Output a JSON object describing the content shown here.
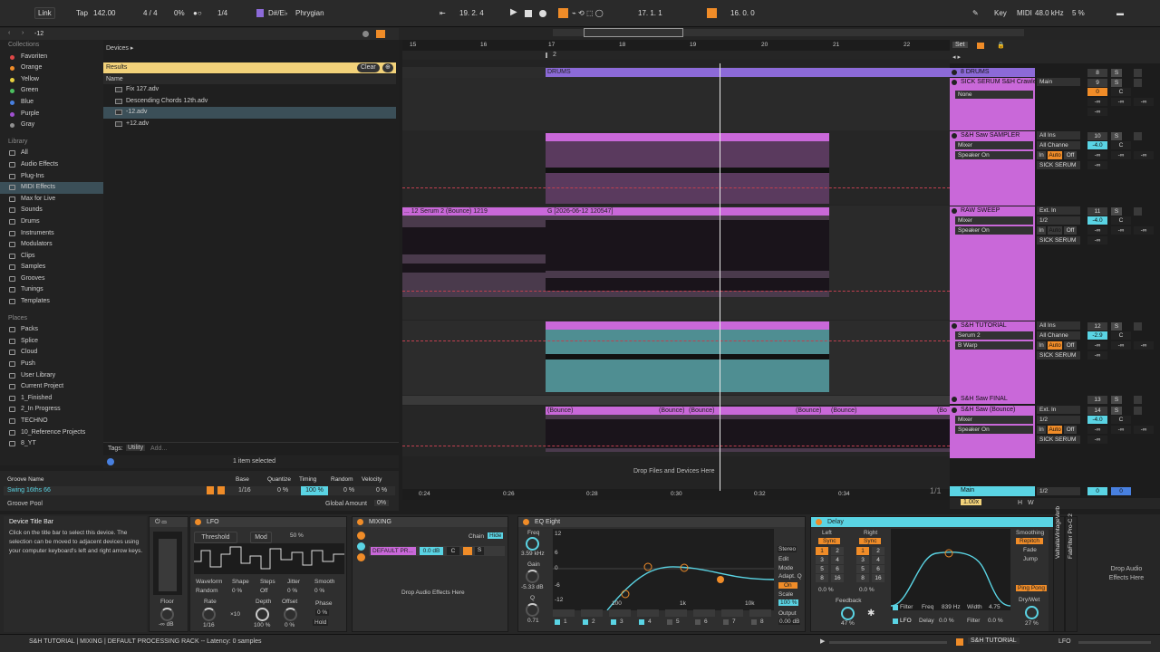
{
  "topbar": {
    "link": "Link",
    "tap": "Tap",
    "tempo": "142.00",
    "signature": "4 / 4",
    "cpu_pct": "0%",
    "quantize": "1/4",
    "key_root": "D#/E♭",
    "scale": "Phrygian",
    "arrangement_pos": "19.  2.  4",
    "loop_start": "17.  1.  1",
    "loop_len": "16.  0.  0",
    "key_label": "Key",
    "midi_label": "MIDI",
    "sample_rate": "48.0 kHz",
    "cpu_load": "5 %"
  },
  "colors": {
    "accent": "#f08c28",
    "drums": "#8c6ad8",
    "track": "#c968d9",
    "cyan": "#5ad4e4",
    "yellow": "#f2d27a"
  },
  "browser": {
    "search_value": "-12",
    "breadcrumb": "Devices ▸",
    "results_label": "Results",
    "clear_label": "Clear",
    "name_header": "Name",
    "files": [
      "Fix 127.adv",
      "Descending Chords 12th.adv",
      "-12.adv",
      "+12.adv"
    ],
    "collections_header": "Collections",
    "collections": [
      {
        "label": "Favoriten",
        "color": "#e04848"
      },
      {
        "label": "Orange",
        "color": "#f08c28"
      },
      {
        "label": "Yellow",
        "color": "#e8d040"
      },
      {
        "label": "Green",
        "color": "#4cc060"
      },
      {
        "label": "Blue",
        "color": "#4880e0"
      },
      {
        "label": "Purple",
        "color": "#a050d0"
      },
      {
        "label": "Gray",
        "color": "#909090"
      }
    ],
    "library_header": "Library",
    "library": [
      "All",
      "Audio Effects",
      "Plug-Ins",
      "MIDI Effects",
      "Max for Live",
      "Sounds",
      "Drums",
      "Instruments",
      "Modulators",
      "Clips",
      "Samples",
      "Grooves",
      "Tunings",
      "Templates"
    ],
    "places_header": "Places",
    "places": [
      "Packs",
      "Splice",
      "Cloud",
      "Push",
      "User Library",
      "Current Project",
      "1_Finished",
      "2_In Progress",
      "TECHNO",
      "10_Reference Projects",
      "8_YT"
    ],
    "tags_label": "Tags:",
    "tag_utility": "Utility",
    "tag_add": "Add...",
    "selection_status": "1 item selected"
  },
  "groove": {
    "headers": [
      "Groove Name",
      "Base",
      "Quantize",
      "Timing",
      "Random",
      "Velocity"
    ],
    "row": {
      "name": "Swing 16ths 66",
      "base": "1/16",
      "quantize": "0 %",
      "timing": "100 %",
      "random": "0 %",
      "velocity": "0 %"
    },
    "pool_label": "Groove Pool",
    "global_amount_label": "Global Amount",
    "global_amount": "0%"
  },
  "ruler": {
    "bars": [
      "15",
      "16",
      "17",
      "18",
      "19",
      "20",
      "21",
      "22"
    ],
    "loop_marker": "2",
    "set_label": "Set",
    "times": [
      "0:24",
      "0:26",
      "0:28",
      "0:30",
      "0:32",
      "0:34"
    ],
    "page": "1/1"
  },
  "clips": {
    "drums": "DRUMS",
    "bounce1": "... 12 Serum 2 (Bounce) 1219",
    "bounce2": "G [2026-06-12 120547]",
    "bounce_small": [
      "(Bounce)",
      "(Bounce)",
      "(Bounce)",
      "(Bounce)",
      "(Bounce)",
      "(Bo"
    ],
    "drop_hint": "Drop Files and Devices Here"
  },
  "tracks": [
    {
      "name": "8 DRUMS",
      "num": "8",
      "color": "#8c6ad8",
      "vol": "",
      "pan": ""
    },
    {
      "name": "SICK SERUM S&H Crawle",
      "num": "9",
      "color": "#c968d9",
      "input": "Main",
      "vol": "0",
      "pan": "C",
      "chain": "None"
    },
    {
      "name": "S&H Saw SAMPLER",
      "num": "10",
      "color": "#c968d9",
      "input": "All Ins",
      "channel": "All Channe",
      "vol": "-4.0",
      "pan": "C",
      "dev1": "Mixer",
      "dev2": "Speaker On",
      "out": "SICK SERUM"
    },
    {
      "name": "RAW SWEEP",
      "num": "11",
      "color": "#c968d9",
      "input": "Ext. In",
      "channel": "1/2",
      "vol": "-4.0",
      "pan": "C",
      "dev1": "Mixer",
      "dev2": "Speaker On",
      "out": "SICK SERUM"
    },
    {
      "name": "S&H TUTORIAL",
      "num": "12",
      "color": "#c968d9",
      "input": "All Ins",
      "channel": "All Channe",
      "vol": "-2.9",
      "pan": "C",
      "dev1": "Serum 2",
      "dev2": "B Warp",
      "out": "SICK SERUM"
    },
    {
      "name": "S&H Saw FINAL",
      "num": "13",
      "color": "#c968d9"
    },
    {
      "name": "S&H Saw (Bounce)",
      "num": "14",
      "color": "#c968d9",
      "input": "Ext. In",
      "channel": "1/2",
      "vol": "-4.0",
      "pan": "C",
      "dev1": "Mixer",
      "dev2": "Speaker On",
      "out": "SICK SERUM"
    }
  ],
  "mixer_labels": {
    "in": "In",
    "auto": "Auto",
    "off": "Off",
    "s": "S",
    "neg_inf": "-∞",
    "main": "Main",
    "main_out": "1/2",
    "main_vol": "0",
    "main_pan": "0",
    "zoom": "1.00x",
    "h": "H",
    "w": "W"
  },
  "info": {
    "title": "Device Title Bar",
    "text": "Click on the title bar to select this device. The selection can be moved to adjacent devices using your computer keyboard's left and right arrow keys."
  },
  "utility": {
    "floor_label": "Floor",
    "floor_value": "-∞ dB"
  },
  "lfo": {
    "title": "LFO",
    "threshold": "Threshold",
    "mod": "Mod",
    "pct": "50 %",
    "labels": [
      "Waveform",
      "Shape",
      "Steps",
      "Jitter",
      "Smooth"
    ],
    "values": [
      "Random",
      "0 %",
      "Off",
      "0 %",
      "0 %"
    ],
    "rate_label": "Rate",
    "rate": "1/16",
    "depth_label": "Depth",
    "depth": "100 %",
    "offset_label": "Offset",
    "offset": "0 %",
    "phase_label": "Phase",
    "phase": "0 %",
    "hold": "Hold",
    "mult": "×10"
  },
  "mixing": {
    "title": "MIXING",
    "chain": "Chain",
    "hide": "Hide",
    "preset": "DEFAULT PR...",
    "gain": "0.0 dB",
    "pan": "C",
    "drop": "Drop Audio Effects Here"
  },
  "eq": {
    "title": "EQ Eight",
    "freq_label": "Freq",
    "freq": "3.59 kHz",
    "gain_label": "Gain",
    "gain": "-5.33 dB",
    "q_label": "Q",
    "q": "0.71",
    "db_ticks": [
      "12",
      "6",
      "0",
      "-6",
      "-12"
    ],
    "hz_ticks": [
      "100",
      "1k",
      "10k"
    ],
    "mode_label": "Mode",
    "mode": "Stereo",
    "edit_label": "Edit",
    "adapt_label": "Adapt. Q",
    "adapt": "On",
    "scale_label": "Scale",
    "scale": "100 %",
    "output_label": "Output",
    "output": "0.00 dB",
    "bands": [
      "1",
      "2",
      "3",
      "4",
      "5",
      "6",
      "7",
      "8"
    ]
  },
  "delay": {
    "title": "Delay",
    "left": "Left",
    "right": "Right",
    "sync": "Sync",
    "left_pct": "0.0 %",
    "right_pct": "0.0 %",
    "grid": [
      "1",
      "2",
      "3",
      "4",
      "5",
      "6",
      "8",
      "16"
    ],
    "feedback_label": "Feedback",
    "feedback": "47 %",
    "filter": "Filter",
    "freq_label": "Freq",
    "freq": "839 Hz",
    "width_label": "Width",
    "width": "4.75",
    "smoothing_label": "Smoothing",
    "repitch": "Repitch",
    "fade": "Fade",
    "jump": "Jump",
    "ping_pong": "Ping Pong",
    "drywet_label": "Dry/Wet",
    "drywet": "27 %",
    "lfo": "LFO",
    "lfo_delay_label": "Delay",
    "lfo_delay": "0.0 %",
    "lfo_filter_label": "Filter",
    "lfo_filter": "0.0 %"
  },
  "plugins": [
    "ValhallaVintageVerb",
    "FabFilter Pro-C 2"
  ],
  "drop_right": "Drop Audio Effects Here",
  "status": {
    "path": "S&H TUTORIAL | MIXING | DEFAULT PROCESSING RACK -- Latency: 0 samples",
    "track": "S&H TUTORIAL",
    "lfo": "LFO"
  }
}
